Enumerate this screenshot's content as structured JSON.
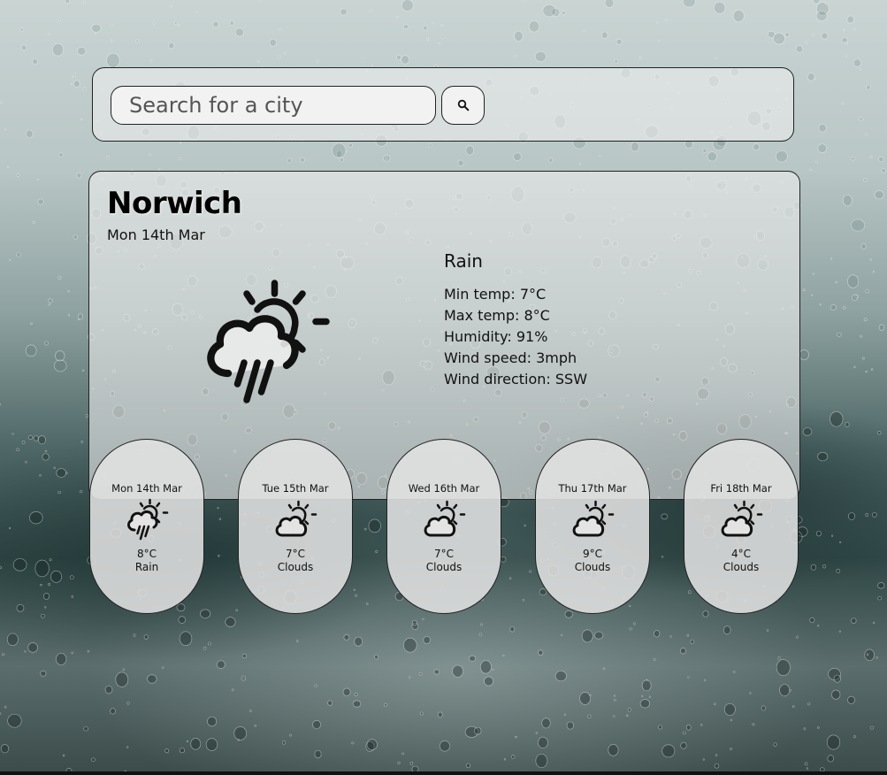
{
  "search": {
    "placeholder": "Search for a city",
    "button_icon": "search-icon"
  },
  "current": {
    "city": "Norwich",
    "date": "Mon 14th Mar",
    "icon": "rain-sun-icon",
    "condition": "Rain",
    "min_temp": "Min temp: 7°C",
    "max_temp": "Max temp: 8°C",
    "humidity": "Humidity: 91%",
    "wind_speed": "Wind speed: 3mph",
    "wind_direction": "Wind direction: SSW"
  },
  "forecast": [
    {
      "date": "Mon 14th Mar",
      "temp": "8°C",
      "desc": "Rain",
      "icon": "rain-sun-icon"
    },
    {
      "date": "Tue 15th Mar",
      "temp": "7°C",
      "desc": "Clouds",
      "icon": "cloud-sun-icon"
    },
    {
      "date": "Wed 16th Mar",
      "temp": "7°C",
      "desc": "Clouds",
      "icon": "cloud-sun-icon"
    },
    {
      "date": "Thu 17th Mar",
      "temp": "9°C",
      "desc": "Clouds",
      "icon": "cloud-sun-icon"
    },
    {
      "date": "Fri 18th Mar",
      "temp": "4°C",
      "desc": "Clouds",
      "icon": "cloud-sun-icon"
    }
  ]
}
